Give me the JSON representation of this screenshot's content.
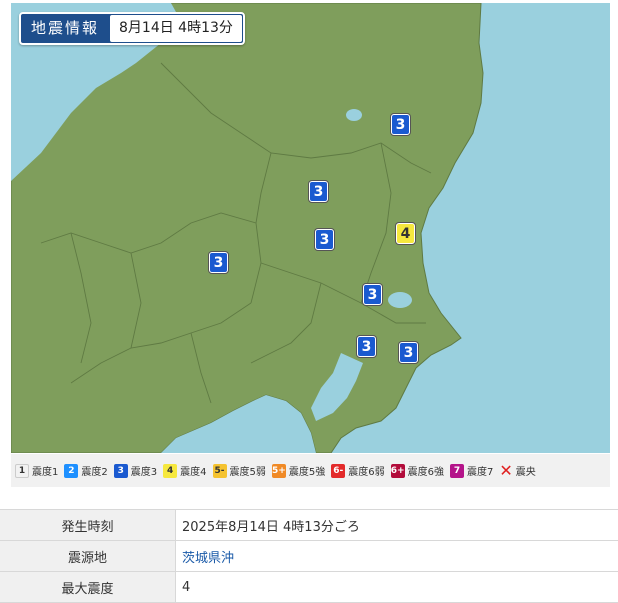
{
  "header": {
    "title": "地震情報",
    "datetime": "8月14日 4時13分"
  },
  "map": {
    "colors": {
      "sea": "#9ad0de",
      "land": "#7f9e5c",
      "border": "#5f7a43"
    },
    "markers": [
      {
        "id": "m1",
        "intensity": "3"
      },
      {
        "id": "m2",
        "intensity": "3"
      },
      {
        "id": "m3",
        "intensity": "3"
      },
      {
        "id": "m4",
        "intensity": "4"
      },
      {
        "id": "m5",
        "intensity": "3"
      },
      {
        "id": "m6",
        "intensity": "3"
      },
      {
        "id": "m7",
        "intensity": "3"
      },
      {
        "id": "m8",
        "intensity": "3"
      }
    ]
  },
  "legend": [
    {
      "code": "1",
      "label": "震度1",
      "color": "#f2f2f2"
    },
    {
      "code": "2",
      "label": "震度2",
      "color": "#1e90ff"
    },
    {
      "code": "3",
      "label": "震度3",
      "color": "#1a5ad0"
    },
    {
      "code": "4",
      "label": "震度4",
      "color": "#f6e83e"
    },
    {
      "code": "5-",
      "label": "震度5弱",
      "color": "#f5c330"
    },
    {
      "code": "5+",
      "label": "震度5強",
      "color": "#f08a26"
    },
    {
      "code": "6-",
      "label": "震度6弱",
      "color": "#e32a2a"
    },
    {
      "code": "6+",
      "label": "震度6強",
      "color": "#b20b3a"
    },
    {
      "code": "7",
      "label": "震度7",
      "color": "#b4148a"
    },
    {
      "code": "x",
      "label": "震央",
      "icon": "epicenter-icon",
      "color": "#e02020"
    }
  ],
  "info": [
    {
      "label": "発生時刻",
      "value": "2025年8月14日 4時13分ごろ"
    },
    {
      "label": "震源地",
      "value": "茨城県沖"
    },
    {
      "label": "最大震度",
      "value": "4"
    }
  ]
}
